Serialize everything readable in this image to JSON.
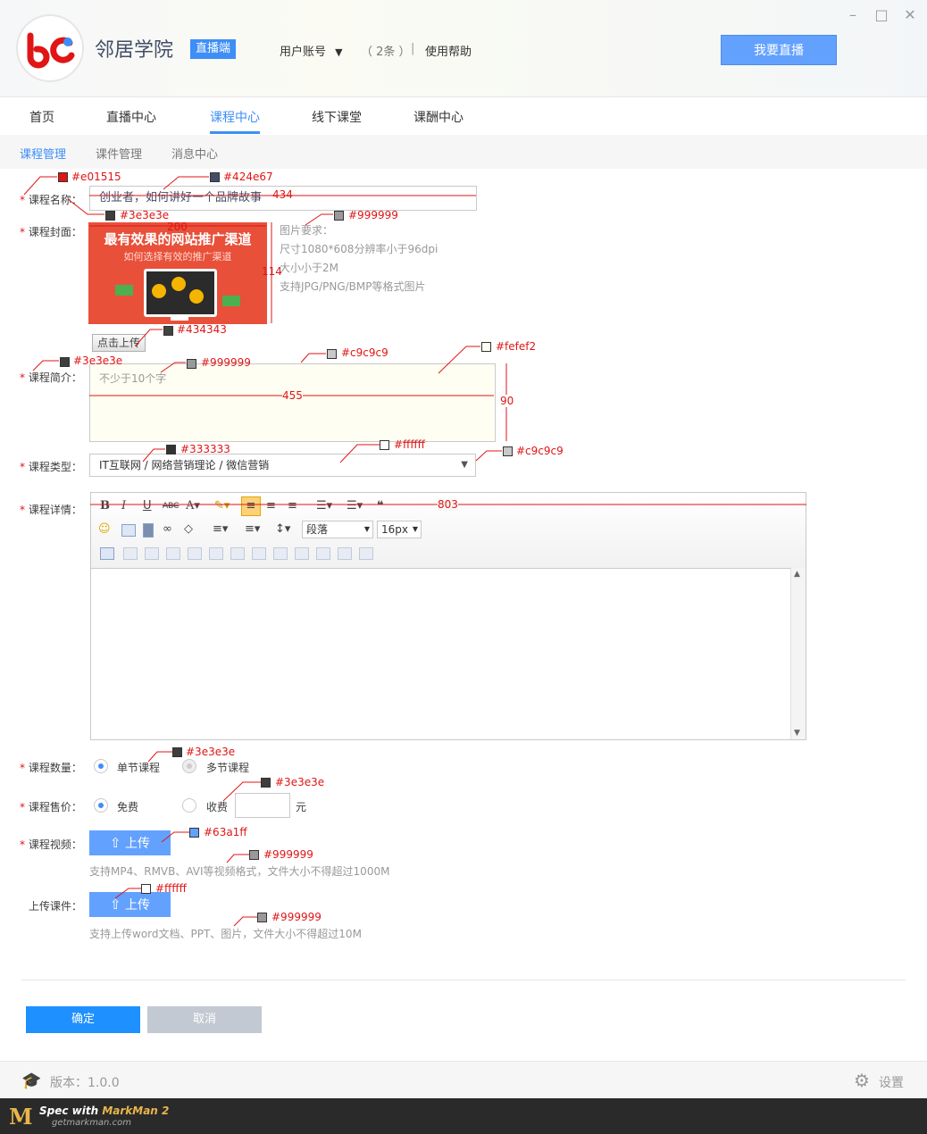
{
  "app": {
    "name": "邻居学院",
    "badge": "直播端",
    "user_menu": "用户账号",
    "message_count": "（ 2条 ）",
    "separator": "|",
    "help": "使用帮助",
    "live_button": "我要直播"
  },
  "nav": {
    "items": [
      "首页",
      "直播中心",
      "课程中心",
      "线下课堂",
      "课酬中心"
    ],
    "active": "课程中心"
  },
  "subnav": {
    "items": [
      "课程管理",
      "课件管理",
      "消息中心"
    ],
    "active": "课程管理"
  },
  "form": {
    "required_mark": "*",
    "name_label": "课程名称：",
    "name_value": "创业者，如何讲好一个品牌故事",
    "cover_label": "课程封面：",
    "cover_title": "最有效果的网站推广渠道",
    "cover_subtitle": "如何选择有效的推广渠道",
    "cover_requirements": [
      "图片要求：",
      "尺寸1080*608分辨率小于96dpi",
      "大小小于2M",
      "支持JPG/PNG/BMP等格式图片"
    ],
    "upload_cover": "点击上传",
    "intro_label": "课程简介：",
    "intro_placeholder": "不少于10个字",
    "type_label": "课程类型：",
    "type_value": "IT互联网 / 网络营销理论 / 微信营销",
    "detail_label": "课程详情：",
    "editor_paragraph": "段落",
    "editor_fontsize": "16px",
    "count_label": "课程数量：",
    "count_options": [
      "单节课程",
      "多节课程"
    ],
    "price_label": "课程售价：",
    "price_options": [
      "免费",
      "收费"
    ],
    "price_unit": "元",
    "video_label": "课程视频：",
    "upload_label": "上传",
    "video_hint": "支持MP4、RMVB、AVI等视频格式，文件大小不得超过1000M",
    "courseware_label": "上传课件：",
    "courseware_hint": "支持上传word文档、PPT、图片，文件大小不得超过10M",
    "confirm": "确定",
    "cancel": "取消"
  },
  "footer": {
    "version": "版本：1.0.0",
    "settings": "设置"
  },
  "markman": {
    "spec": "Spec with",
    "brand": "MarkMan 2",
    "url": "getmarkman.com"
  },
  "annotations": {
    "c1": "#e01515",
    "c2": "#424e67",
    "c3": "#3e3e3e",
    "w434": "434",
    "w200": "200",
    "c4": "#999999",
    "h114": "114",
    "c5": "#434343",
    "c6": "#3e3e3e",
    "c7": "#999999",
    "c8": "#c9c9c9",
    "c9": "#fefef2",
    "w455": "455",
    "h90": "90",
    "c10": "#333333",
    "c11": "#ffffff",
    "c12": "#c9c9c9",
    "w803": "803",
    "c13": "#3e3e3e",
    "c14": "#3e3e3e",
    "c15": "#63a1ff",
    "c16": "#999999",
    "c17": "#ffffff",
    "c18": "#999999"
  },
  "colors": {
    "accent": "#3e8ef7",
    "button": "#63a1ff",
    "required": "#e01515",
    "text": "#3e3e3e",
    "hint": "#999999"
  }
}
